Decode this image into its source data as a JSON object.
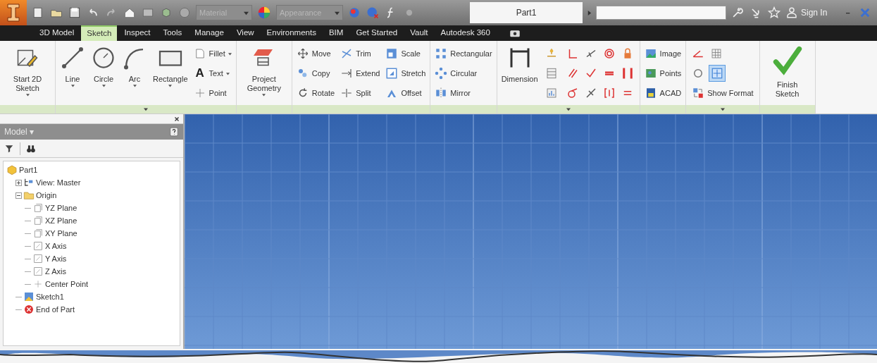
{
  "title_bar": {
    "material": "Material",
    "appearance": "Appearance",
    "document_title": "Part1",
    "sign_in": "Sign In"
  },
  "tabs": [
    {
      "label": "3D Model",
      "selected": false
    },
    {
      "label": "Sketch",
      "selected": true
    },
    {
      "label": "Inspect",
      "selected": false
    },
    {
      "label": "Tools",
      "selected": false
    },
    {
      "label": "Manage",
      "selected": false
    },
    {
      "label": "View",
      "selected": false
    },
    {
      "label": "Environments",
      "selected": false
    },
    {
      "label": "BIM",
      "selected": false
    },
    {
      "label": "Get Started",
      "selected": false
    },
    {
      "label": "Vault",
      "selected": false
    },
    {
      "label": "Autodesk 360",
      "selected": false
    }
  ],
  "ribbon": {
    "panels": [
      {
        "footer_menu": false,
        "columns": [
          {
            "kind": "large",
            "items": [
              {
                "label": "Start 2D Sketch",
                "dropdown": true
              }
            ]
          }
        ]
      },
      {
        "footer_menu": true,
        "columns": [
          {
            "kind": "large",
            "items": [
              {
                "label": "Line",
                "dropdown": true
              }
            ]
          },
          {
            "kind": "large",
            "items": [
              {
                "label": "Circle",
                "dropdown": true
              }
            ]
          },
          {
            "kind": "large",
            "items": [
              {
                "label": "Arc",
                "dropdown": true
              }
            ]
          },
          {
            "kind": "large",
            "items": [
              {
                "label": "Rectangle",
                "dropdown": true
              }
            ]
          },
          {
            "kind": "stack",
            "items": [
              {
                "label": "Fillet",
                "dropdown": true
              },
              {
                "label": "Text",
                "dropdown": true,
                "glyph": "A"
              },
              {
                "label": "Point",
                "dropdown": false
              }
            ]
          }
        ]
      },
      {
        "footer_menu": false,
        "columns": [
          {
            "kind": "large",
            "items": [
              {
                "label": "Project Geometry",
                "dropdown": true
              }
            ]
          }
        ]
      },
      {
        "footer_menu": false,
        "columns": [
          {
            "kind": "stack",
            "items": [
              {
                "label": "Move",
                "dropdown": false
              },
              {
                "label": "Copy",
                "dropdown": false
              },
              {
                "label": "Rotate",
                "dropdown": false
              }
            ]
          },
          {
            "kind": "stack",
            "items": [
              {
                "label": "Trim",
                "dropdown": false
              },
              {
                "label": "Extend",
                "dropdown": false
              },
              {
                "label": "Split",
                "dropdown": false
              }
            ]
          },
          {
            "kind": "stack",
            "items": [
              {
                "label": "Scale",
                "dropdown": false
              },
              {
                "label": "Stretch",
                "dropdown": false
              },
              {
                "label": "Offset",
                "dropdown": false
              }
            ]
          }
        ]
      },
      {
        "footer_menu": false,
        "columns": [
          {
            "kind": "stack",
            "items": [
              {
                "label": "Rectangular",
                "dropdown": false
              },
              {
                "label": "Circular",
                "dropdown": false
              },
              {
                "label": "Mirror",
                "dropdown": false
              }
            ]
          }
        ]
      },
      {
        "footer_menu": true,
        "columns": [
          {
            "kind": "large",
            "items": [
              {
                "label": "Dimension",
                "dropdown": false
              }
            ]
          },
          {
            "kind": "grid",
            "rows": [
              [
                {}
              ],
              [
                {}
              ],
              [
                {}
              ]
            ]
          },
          {
            "kind": "grid",
            "rows": [
              [
                {},
                {},
                {},
                {}
              ],
              [
                {},
                {},
                {},
                {}
              ],
              [
                {},
                {},
                {},
                {}
              ]
            ]
          }
        ]
      },
      {
        "footer_menu": false,
        "columns": [
          {
            "kind": "stack",
            "items": [
              {
                "label": "Image",
                "dropdown": false
              },
              {
                "label": "Points",
                "dropdown": false
              },
              {
                "label": "ACAD",
                "dropdown": false
              }
            ]
          }
        ]
      },
      {
        "footer_menu": true,
        "columns": [
          {
            "kind": "grid",
            "rows": [
              [
                {
                  "selected": false
                },
                {
                  "selected": false
                }
              ],
              [
                {
                  "selected": false
                },
                {
                  "selected": true
                }
              ],
              [
                {
                  "label": "Show Format",
                  "selected": false
                }
              ]
            ]
          }
        ]
      },
      {
        "footer_menu": false,
        "columns": [
          {
            "kind": "large",
            "items": [
              {
                "label": "Finish Sketch",
                "dropdown": false
              }
            ]
          }
        ]
      }
    ]
  },
  "browser": {
    "title": "Model ▾",
    "tree": [
      {
        "label": "Part1",
        "kind": "part",
        "children": [
          {
            "label": "View: Master",
            "kind": "view",
            "expanded": false
          },
          {
            "label": "Origin",
            "kind": "folder",
            "expanded": true,
            "children": [
              {
                "label": "YZ Plane",
                "kind": "plane"
              },
              {
                "label": "XZ Plane",
                "kind": "plane"
              },
              {
                "label": "XY Plane",
                "kind": "plane"
              },
              {
                "label": "X Axis",
                "kind": "axis"
              },
              {
                "label": "Y Axis",
                "kind": "axis"
              },
              {
                "label": "Z Axis",
                "kind": "axis"
              },
              {
                "label": "Center Point",
                "kind": "point"
              }
            ]
          },
          {
            "label": "Sketch1",
            "kind": "sketch"
          },
          {
            "label": "End of Part",
            "kind": "end"
          }
        ]
      }
    ]
  }
}
